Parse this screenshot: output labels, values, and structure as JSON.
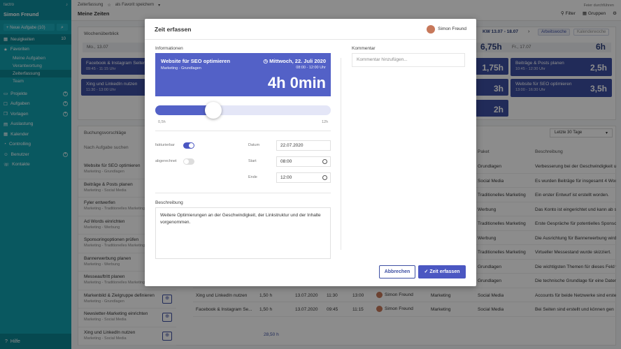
{
  "sidebar": {
    "brand": "factro",
    "user": "Simon Freund",
    "new_task": "Neue Aufgabe",
    "new_task_count": "(10)",
    "items": [
      {
        "label": "Neuigkeiten",
        "badge": "10"
      },
      {
        "label": "Favoriten"
      }
    ],
    "fav_subs": [
      "Meine Aufgaben",
      "Verantwortung",
      "Zeiterfassung",
      "Team"
    ],
    "groups": [
      "Projekte",
      "Aufgaben",
      "Vorlagen",
      "Auslastung",
      "Kalender",
      "Controlling",
      "Benutzer",
      "Kontakte"
    ],
    "help": "Hilfe"
  },
  "topbar": {
    "crumb": "Zeiterfassung",
    "fav": "als Favorit speichern",
    "title": "Meine Zeiten",
    "filter": "Filter",
    "groups": "Gruppen",
    "feier": "Feier durchführen"
  },
  "week": {
    "title": "Wochenüberblick",
    "kw": "KW 13.07 - 18.07",
    "seg1": "Arbeitswoche",
    "seg2": "Kalenderwoche",
    "mon": "Mo., 13.07",
    "fri": "Fr., 17.07",
    "mon_total": "6,75h",
    "fri_total": "6h",
    "cards": [
      {
        "title": "Facebook & Instagram Seiten",
        "time": "09:45 - 11:15 Uhr"
      },
      {
        "title": "Xing und LinkedIn nutzen",
        "time": "11:30 - 13:00 Uhr"
      },
      {
        "title": "Beiträge & Posts planen",
        "time": "10:45 - 12:30 Uhr",
        "hours": "2,5h"
      },
      {
        "title": "Website für SEO optimieren",
        "time": "13:00 - 16:30 Uhr",
        "hours": "3,5h"
      }
    ],
    "mid_hours": [
      "1,75h",
      "3h",
      "2h"
    ]
  },
  "booking": {
    "title": "Buchungsvorschläge",
    "range": "Letzte 30 Tage",
    "search": "Nach Aufgabe suchen",
    "tasks": [
      {
        "name": "Website für SEO optimieren",
        "cat": "Marketing - Grundlagen"
      },
      {
        "name": "Beiträge & Posts planen",
        "cat": "Marketing - Social Media"
      },
      {
        "name": "Fyler entwerfen",
        "cat": "Marketing - Traditionelles Marketing"
      },
      {
        "name": "Ad Words einrichten",
        "cat": "Marketing - Werbung"
      },
      {
        "name": "Sponsoringoptionen prüfen",
        "cat": "Marketing - Traditionelles Marketing"
      },
      {
        "name": "Bannerwerbung planen",
        "cat": "Marketing - Werbung"
      },
      {
        "name": "Messeauftritt planen",
        "cat": "Marketing - Traditionelles Marketing"
      },
      {
        "name": "Markenbild & Zielgruppe definieren",
        "cat": "Marketing - Grundlagen"
      },
      {
        "name": "Newsletter-Marketing einrichten",
        "cat": "Marketing - Social Media"
      },
      {
        "name": "Xing und LinkedIn nutzen",
        "cat": "Marketing - Social Media"
      }
    ],
    "headers": {
      "paket": "Paket",
      "beschreibung": "Beschreibung"
    },
    "rows": [
      {
        "paket": "Grundlagen",
        "desc": "Verbesserung bei der Geschwindigkeit u"
      },
      {
        "paket": "Social Media",
        "desc": "Es wurden Beiträge für insgesamt 4 Woc"
      },
      {
        "paket": "Traditionelles Marketing",
        "desc": "Ein erster Entwurf ist erstellt worden."
      },
      {
        "paket": "Werbung",
        "desc": "Das Konto ist eingerichtet und kann ab s"
      },
      {
        "paket": "Traditionelles Marketing",
        "desc": "Erste Gespräche für potentielles Sponso"
      },
      {
        "paket": "Werbung",
        "desc": "Die Ausrichtung für Bannerwerbung wird"
      },
      {
        "paket": "Traditionelles Marketing",
        "desc": "Virtueller Messestand wurde skizziert."
      },
      {
        "paket": "Grundlagen",
        "desc": "Die wichtigsten Themen für dieses Feld w"
      },
      {
        "paket": "Grundlagen",
        "desc": "Die technische Grundlage für eine Datenl"
      }
    ],
    "full_rows": [
      {
        "task": "Xing und LinkedIn nutzen",
        "h": "1,50 h",
        "date": "13.07.2020",
        "from": "11:30",
        "to": "13:00",
        "user": "Simon Freund",
        "proj": "Marketing",
        "paket": "Social Media",
        "desc": "Accounts für beide Netzwerke sind erste"
      },
      {
        "task": "Facebook & Instagram Se...",
        "h": "1,50 h",
        "date": "13.07.2020",
        "from": "09:45",
        "to": "11:15",
        "user": "Simon Freund",
        "proj": "Marketing",
        "paket": "Social Media",
        "desc": "Bei Seiten sind erstellt und können gen"
      }
    ],
    "total": "28,50 h"
  },
  "modal": {
    "title": "Zeit erfassen",
    "user": "Simon Freund",
    "info_label": "Informationen",
    "comment_label": "Kommentar",
    "comment_placeholder": "Kommentar hinzufügen...",
    "task": {
      "title": "Website für SEO optimieren",
      "cat": "Marketing - Grundlagen",
      "date": "Mittwoch, 22. Juli 2020",
      "time": "08:00 - 12:00 Uhr",
      "hours": "4h 0min"
    },
    "slider": {
      "min": "0,5h",
      "max": "12h",
      "value_fraction": 0.33
    },
    "fakt": "fakturierbar",
    "abger": "abgerechnet",
    "datum_label": "Datum",
    "start_label": "Start",
    "ende_label": "Ende",
    "datum": "22.07.2020",
    "start": "08:00",
    "ende": "12:00",
    "desc_label": "Beschreibung",
    "desc": "Weitere Optimierungen an der Geschwindigkeit, der Linkstruktur und der Inhalte vorgenommen.",
    "cancel": "Abbrechen",
    "submit": "Zeit erfassen"
  },
  "colors": {
    "sidebar": "#12a0b0",
    "accent": "#5361c7",
    "card": "#3d4fa3"
  }
}
